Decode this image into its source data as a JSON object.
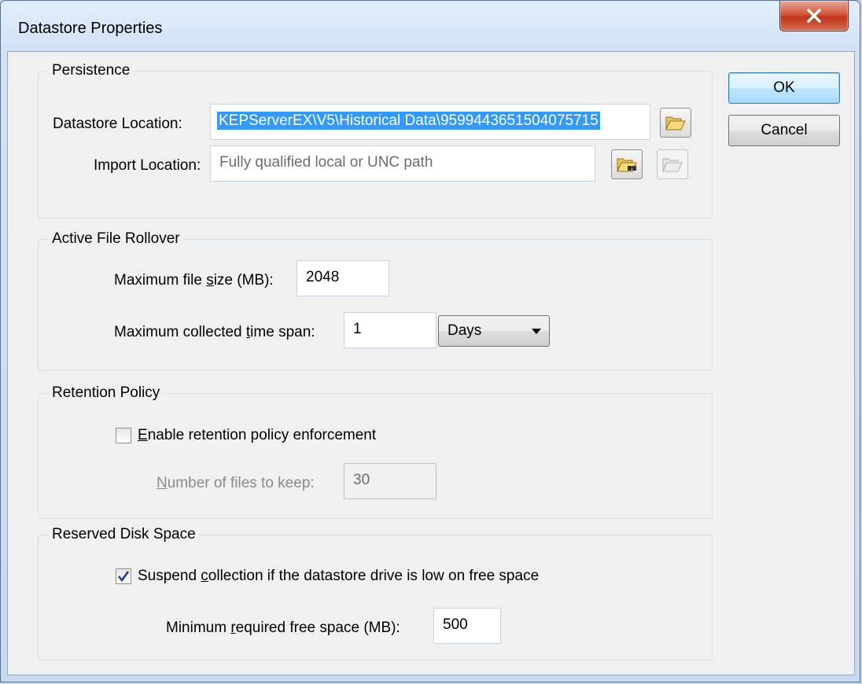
{
  "window": {
    "title": "Datastore Properties",
    "close_glyph": "X"
  },
  "buttons": {
    "ok": "OK",
    "cancel": "Cancel"
  },
  "persistence": {
    "group_label": "Persistence",
    "datastore_location_label": "Datastore Location:",
    "datastore_location_value": "KEPServerEX\\V5\\Historical Data\\9599443651504075715",
    "import_location_label": "Import Location:",
    "import_location_placeholder": "Fully qualified local or UNC path",
    "icons": {
      "browse_datastore": "folder-open-icon",
      "browse_import": "folder-search-icon",
      "import_folder_disabled": "folder-open-icon"
    }
  },
  "rollover": {
    "group_label": "Active File Rollover",
    "max_file_size_label_pre": "Maximum file ",
    "max_file_size_label_u": "s",
    "max_file_size_label_post": "ize (MB):",
    "max_file_size_value": "2048",
    "max_time_span_label_pre": "Maximum collected ",
    "max_time_span_label_u": "t",
    "max_time_span_label_post": "ime span:",
    "max_time_span_value": "1",
    "time_unit_selected": "Days"
  },
  "retention": {
    "group_label": "Retention Policy",
    "enable_label_u": "E",
    "enable_label_post": "nable retention policy enforcement",
    "enable_checked": false,
    "files_to_keep_label_u": "N",
    "files_to_keep_label_post": "umber of files to keep:",
    "files_to_keep_value": "30"
  },
  "disk_space": {
    "group_label": "Reserved Disk Space",
    "suspend_label_pre": "Suspend ",
    "suspend_label_u": "c",
    "suspend_label_post": "ollection if the datastore drive is low on free space",
    "suspend_checked": true,
    "min_free_label_pre": "Minimum ",
    "min_free_label_u": "r",
    "min_free_label_post": "equired free space (MB):",
    "min_free_value": "500"
  },
  "colors": {
    "selection": "#3399ff",
    "close_button": "#c7432a",
    "default_button": "#bee6fd"
  }
}
